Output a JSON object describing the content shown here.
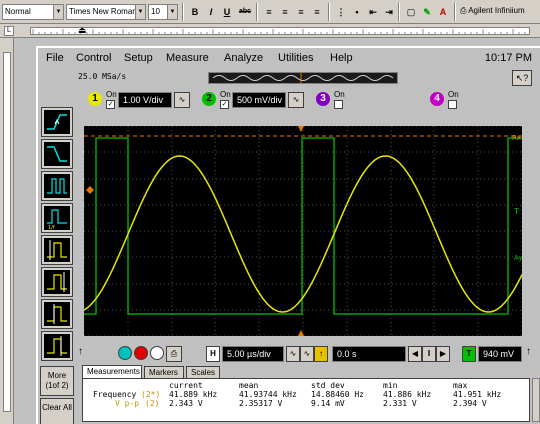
{
  "word_toolbar": {
    "style": "Normal",
    "font": "Times New Roman",
    "size": "10",
    "bold": "B",
    "italic": "I",
    "underline": "U",
    "strike": "abc",
    "printer": "Agilent Infiniium"
  },
  "menu": {
    "items": [
      "File",
      "Control",
      "Setup",
      "Measure",
      "Analyze",
      "Utilities",
      "Help"
    ],
    "clock": "10:17 PM"
  },
  "acquisition": {
    "sample_rate": "25.0 MSa/s"
  },
  "channels": [
    {
      "num": "1",
      "on": true,
      "on_label": "On",
      "scale": "1.00 V/div",
      "color": "#e8e800"
    },
    {
      "num": "2",
      "on": true,
      "on_label": "On",
      "scale": "500 mV/div",
      "color": "#00c000"
    },
    {
      "num": "3",
      "on": false,
      "on_label": "On",
      "color": "#8000c0"
    },
    {
      "num": "4",
      "on": false,
      "on_label": "On",
      "color": "#c000c0"
    }
  ],
  "left_tools": {
    "more_label": "More (1of 2)",
    "clear_label": "Clear All"
  },
  "timebase": {
    "label_h": "H",
    "scale": "5.00 µs/div",
    "delay": "0.0 s",
    "label_t": "T",
    "trigger_level": "940 mV"
  },
  "tabs": [
    "Measurements",
    "Markers",
    "Scales"
  ],
  "measurements": {
    "headers": [
      "current",
      "mean",
      "std dev",
      "min",
      "max"
    ],
    "rows": [
      {
        "name": "Frequency",
        "ch": "(2*)",
        "values": [
          "41.889 kHz",
          "41.93744 kHz",
          "14.88460  Hz",
          "41.886 kHz",
          "41.951 kHz"
        ]
      },
      {
        "name": "V p-p",
        "ch": "(2)",
        "values": [
          "2.343 V",
          "2.35317 V",
          "9.14 mV",
          "2.331 V",
          "2.394 V"
        ]
      }
    ]
  },
  "display_markers": {
    "right_top": "Rx",
    "right_mid": "T",
    "right_low": "Ay"
  },
  "colors": {
    "ch1": "#e8e800",
    "ch2": "#00c000",
    "grid": "#505050",
    "ref": "#e87800"
  }
}
